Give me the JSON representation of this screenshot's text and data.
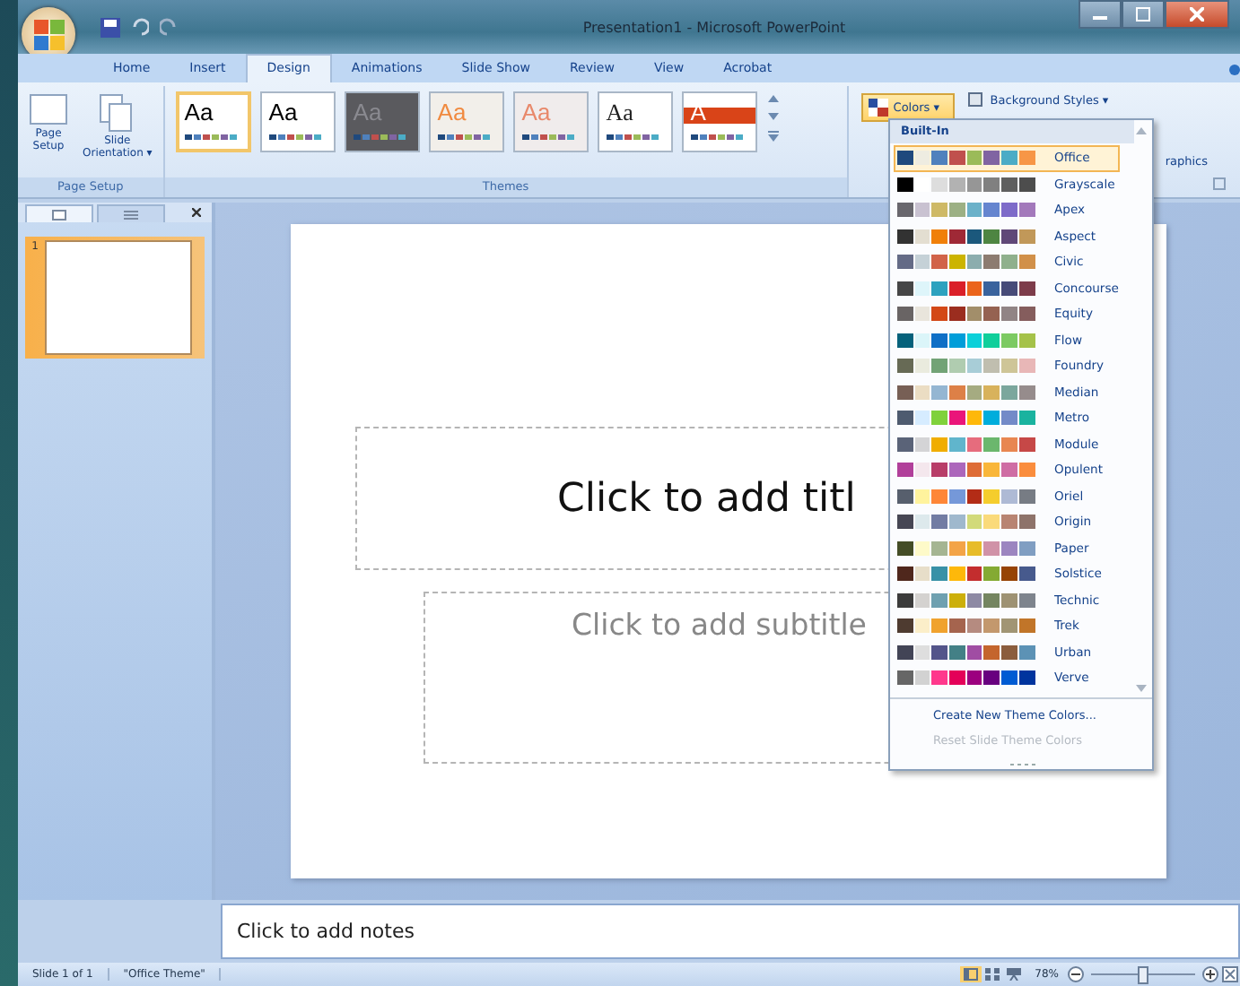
{
  "window": {
    "title": "Presentation1 - Microsoft PowerPoint"
  },
  "tabs": [
    {
      "label": "Home",
      "selected": false
    },
    {
      "label": "Insert",
      "selected": false
    },
    {
      "label": "Design",
      "selected": true
    },
    {
      "label": "Animations",
      "selected": false
    },
    {
      "label": "Slide Show",
      "selected": false
    },
    {
      "label": "Review",
      "selected": false
    },
    {
      "label": "View",
      "selected": false
    },
    {
      "label": "Acrobat",
      "selected": false
    }
  ],
  "page_setup": {
    "buttons": [
      {
        "kind": "page",
        "label": "Page\nSetup"
      },
      {
        "kind": "orientation",
        "label": "Slide\nOrientation ▾"
      }
    ],
    "group_label": "Page Setup"
  },
  "themes": {
    "items": [
      {
        "label": "Aa",
        "kind": "plain",
        "selected": true
      },
      {
        "label": "Aa",
        "kind": "plain",
        "selected": false
      },
      {
        "label": "Aa",
        "kind": "dark",
        "selected": false
      },
      {
        "label": "Aa",
        "kind": "orange",
        "selected": false
      },
      {
        "label": "Aa",
        "kind": "rose",
        "selected": false
      },
      {
        "label": "Aa",
        "kind": "serif",
        "selected": false
      },
      {
        "label": "A",
        "kind": "banner",
        "selected": false
      }
    ],
    "group_label": "Themes"
  },
  "background": {
    "colors_button": "Colors ▾",
    "styles_button": "Background Styles ▾",
    "graphics_label": "raphics"
  },
  "colors_menu": {
    "heading": "Built-In",
    "themes": [
      {
        "name": "Office",
        "selected": true,
        "swatches": [
          {
            "color": "#1f497d"
          },
          {
            "color": "#eeece1"
          },
          {
            "color": "#4f81bd"
          },
          {
            "color": "#c0504d"
          },
          {
            "color": "#9bbb59"
          },
          {
            "color": "#8064a2"
          },
          {
            "color": "#4bacc6"
          },
          {
            "color": "#f79646"
          }
        ]
      },
      {
        "name": "Grayscale",
        "selected": false,
        "swatches": [
          {
            "color": "#000000"
          },
          {
            "color": "#ffffff"
          },
          {
            "color": "#dddddd"
          },
          {
            "color": "#b2b2b2"
          },
          {
            "color": "#969696"
          },
          {
            "color": "#808080"
          },
          {
            "color": "#5f5f5f"
          },
          {
            "color": "#4d4d4d"
          }
        ]
      },
      {
        "name": "Apex",
        "selected": false,
        "swatches": [
          {
            "color": "#69676d"
          },
          {
            "color": "#c9c2d1"
          },
          {
            "color": "#ceb966"
          },
          {
            "color": "#9cb084"
          },
          {
            "color": "#6bb1c9"
          },
          {
            "color": "#6585cf"
          },
          {
            "color": "#7e6bc9"
          },
          {
            "color": "#a379bb"
          }
        ]
      },
      {
        "name": "Aspect",
        "selected": false,
        "swatches": [
          {
            "color": "#323232"
          },
          {
            "color": "#e3ded1"
          },
          {
            "color": "#f07f09"
          },
          {
            "color": "#9f2936"
          },
          {
            "color": "#1b587c"
          },
          {
            "color": "#4e8542"
          },
          {
            "color": "#604878"
          },
          {
            "color": "#c19859"
          }
        ]
      },
      {
        "name": "Civic",
        "selected": false,
        "swatches": [
          {
            "color": "#646b86"
          },
          {
            "color": "#c5d1d7"
          },
          {
            "color": "#d16349"
          },
          {
            "color": "#ccb400"
          },
          {
            "color": "#8cadae"
          },
          {
            "color": "#8c7b70"
          },
          {
            "color": "#8fb08c"
          },
          {
            "color": "#d19049"
          }
        ]
      },
      {
        "name": "Concourse",
        "selected": false,
        "swatches": [
          {
            "color": "#464646"
          },
          {
            "color": "#def5fa"
          },
          {
            "color": "#2da2bf"
          },
          {
            "color": "#da1f28"
          },
          {
            "color": "#eb641b"
          },
          {
            "color": "#39639d"
          },
          {
            "color": "#474b78"
          },
          {
            "color": "#7d3c4a"
          }
        ]
      },
      {
        "name": "Equity",
        "selected": false,
        "swatches": [
          {
            "color": "#696464"
          },
          {
            "color": "#e9e5dc"
          },
          {
            "color": "#d34817"
          },
          {
            "color": "#9b2d1f"
          },
          {
            "color": "#a28e6a"
          },
          {
            "color": "#956251"
          },
          {
            "color": "#918485"
          },
          {
            "color": "#855d5d"
          }
        ]
      },
      {
        "name": "Flow",
        "selected": false,
        "swatches": [
          {
            "color": "#04617b"
          },
          {
            "color": "#dbf5f9"
          },
          {
            "color": "#0f6fc6"
          },
          {
            "color": "#009dd9"
          },
          {
            "color": "#0bd0d9"
          },
          {
            "color": "#10cf9b"
          },
          {
            "color": "#7cca62"
          },
          {
            "color": "#a5c249"
          }
        ]
      },
      {
        "name": "Foundry",
        "selected": false,
        "swatches": [
          {
            "color": "#676a55"
          },
          {
            "color": "#eaebde"
          },
          {
            "color": "#72a376"
          },
          {
            "color": "#b0ccb0"
          },
          {
            "color": "#a8cdd7"
          },
          {
            "color": "#c0beaf"
          },
          {
            "color": "#cec597"
          },
          {
            "color": "#e8b7b7"
          }
        ]
      },
      {
        "name": "Median",
        "selected": false,
        "swatches": [
          {
            "color": "#775f55"
          },
          {
            "color": "#ebddc3"
          },
          {
            "color": "#94b6d2"
          },
          {
            "color": "#dd8047"
          },
          {
            "color": "#a5ab81"
          },
          {
            "color": "#d8b25c"
          },
          {
            "color": "#7ba79d"
          },
          {
            "color": "#968c8c"
          }
        ]
      },
      {
        "name": "Metro",
        "selected": false,
        "swatches": [
          {
            "color": "#4e5b6f"
          },
          {
            "color": "#d6ecff"
          },
          {
            "color": "#7fd13b"
          },
          {
            "color": "#ea157a"
          },
          {
            "color": "#feb80a"
          },
          {
            "color": "#00addc"
          },
          {
            "color": "#738ac8"
          },
          {
            "color": "#1ab39f"
          }
        ]
      },
      {
        "name": "Module",
        "selected": false,
        "swatches": [
          {
            "color": "#5a6378"
          },
          {
            "color": "#d4d4d6"
          },
          {
            "color": "#f0ad00"
          },
          {
            "color": "#60b5cc"
          },
          {
            "color": "#e66c7d"
          },
          {
            "color": "#6bb76d"
          },
          {
            "color": "#e88651"
          },
          {
            "color": "#c64847"
          }
        ]
      },
      {
        "name": "Opulent",
        "selected": false,
        "swatches": [
          {
            "color": "#b13f9a"
          },
          {
            "color": "#f4e7ed"
          },
          {
            "color": "#b83d68"
          },
          {
            "color": "#ac66bb"
          },
          {
            "color": "#de6c36"
          },
          {
            "color": "#f9b639"
          },
          {
            "color": "#cf6da4"
          },
          {
            "color": "#fa8d3d"
          }
        ]
      },
      {
        "name": "Oriel",
        "selected": false,
        "swatches": [
          {
            "color": "#575f6d"
          },
          {
            "color": "#fff39d"
          },
          {
            "color": "#fe8637"
          },
          {
            "color": "#7598d9"
          },
          {
            "color": "#b32c16"
          },
          {
            "color": "#f5cd2d"
          },
          {
            "color": "#aebad5"
          },
          {
            "color": "#777c84"
          }
        ]
      },
      {
        "name": "Origin",
        "selected": false,
        "swatches": [
          {
            "color": "#464653"
          },
          {
            "color": "#dde9ec"
          },
          {
            "color": "#727ca3"
          },
          {
            "color": "#9fb8cd"
          },
          {
            "color": "#d2da7a"
          },
          {
            "color": "#fada7a"
          },
          {
            "color": "#b88472"
          },
          {
            "color": "#8e736a"
          }
        ]
      },
      {
        "name": "Paper",
        "selected": false,
        "swatches": [
          {
            "color": "#444d26"
          },
          {
            "color": "#fefac9"
          },
          {
            "color": "#a5b592"
          },
          {
            "color": "#f3a447"
          },
          {
            "color": "#e7bc29"
          },
          {
            "color": "#d092a7"
          },
          {
            "color": "#9c85c0"
          },
          {
            "color": "#809ec2"
          }
        ]
      },
      {
        "name": "Solstice",
        "selected": false,
        "swatches": [
          {
            "color": "#4f271c"
          },
          {
            "color": "#e7dec9"
          },
          {
            "color": "#3891a7"
          },
          {
            "color": "#feb80a"
          },
          {
            "color": "#c32d2e"
          },
          {
            "color": "#84aa33"
          },
          {
            "color": "#964305"
          },
          {
            "color": "#475a8d"
          }
        ]
      },
      {
        "name": "Technic",
        "selected": false,
        "swatches": [
          {
            "color": "#3b3b3b"
          },
          {
            "color": "#d4d2d0"
          },
          {
            "color": "#6ea0b0"
          },
          {
            "color": "#ccaf0a"
          },
          {
            "color": "#8d89a4"
          },
          {
            "color": "#748560"
          },
          {
            "color": "#9e9273"
          },
          {
            "color": "#7e848d"
          }
        ]
      },
      {
        "name": "Trek",
        "selected": false,
        "swatches": [
          {
            "color": "#4e3b30"
          },
          {
            "color": "#fbeec9"
          },
          {
            "color": "#f0a22e"
          },
          {
            "color": "#a5644e"
          },
          {
            "color": "#b58b80"
          },
          {
            "color": "#c3986d"
          },
          {
            "color": "#a19574"
          },
          {
            "color": "#c17529"
          }
        ]
      },
      {
        "name": "Urban",
        "selected": false,
        "swatches": [
          {
            "color": "#424456"
          },
          {
            "color": "#dedede"
          },
          {
            "color": "#53548a"
          },
          {
            "color": "#438086"
          },
          {
            "color": "#a04da3"
          },
          {
            "color": "#c4652d"
          },
          {
            "color": "#8b5d3d"
          },
          {
            "color": "#5c92b5"
          }
        ]
      },
      {
        "name": "Verve",
        "selected": false,
        "swatches": [
          {
            "color": "#666666"
          },
          {
            "color": "#d2d2d2"
          },
          {
            "color": "#ff388c"
          },
          {
            "color": "#e40059"
          },
          {
            "color": "#9c007f"
          },
          {
            "color": "#68007f"
          },
          {
            "color": "#005bd3"
          },
          {
            "color": "#00349e"
          }
        ]
      }
    ],
    "actions": [
      {
        "label": "Create New Theme Colors...",
        "disabled": false
      },
      {
        "label": "Reset Slide Theme Colors",
        "disabled": true
      }
    ]
  },
  "slides_panel": {
    "slides": [
      {
        "number": "1",
        "selected": true
      }
    ]
  },
  "slide": {
    "title_placeholder": "Click to add titl",
    "subtitle_placeholder": "Click to add subtitle"
  },
  "notes": {
    "placeholder": "Click to add notes"
  },
  "status_bar": {
    "slide": "Slide 1 of 1",
    "theme": "\"Office Theme\"",
    "zoom": "78%",
    "zoom_slider": {
      "level": 0.45
    }
  }
}
